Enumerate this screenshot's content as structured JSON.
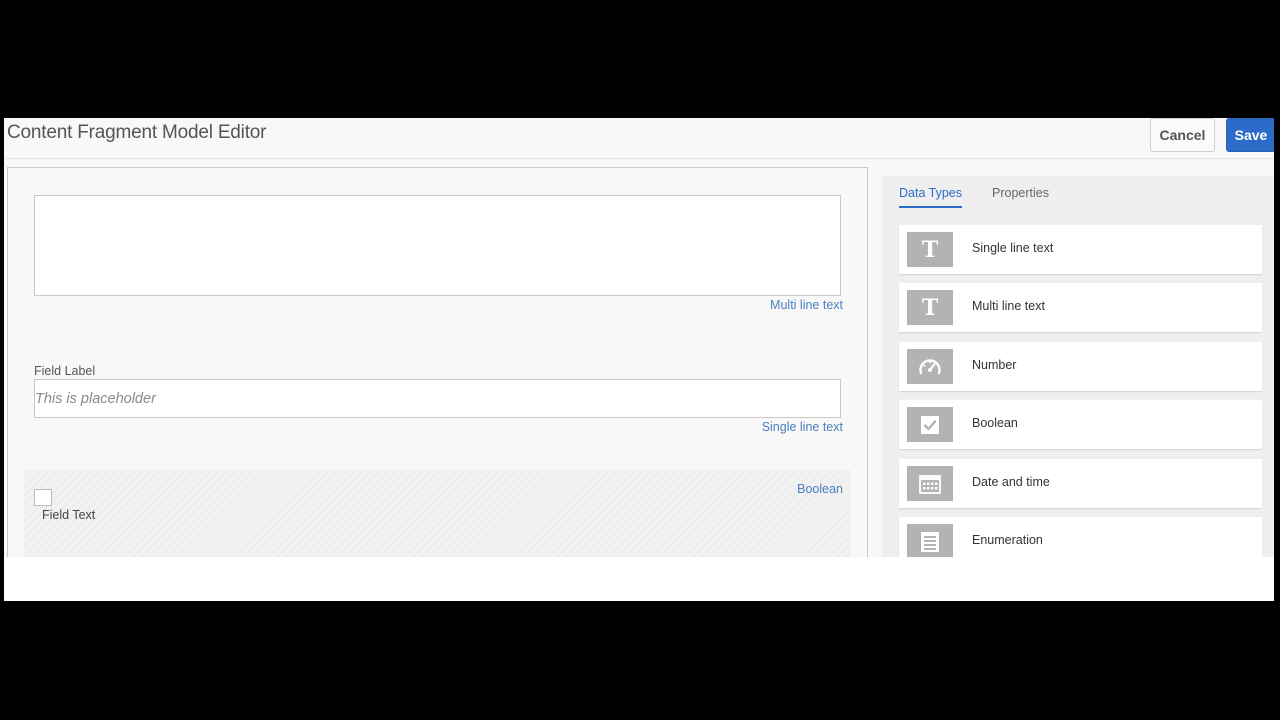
{
  "header": {
    "title": "Content Fragment Model Editor",
    "cancel_label": "Cancel",
    "save_label": "Save",
    "accent_color": "#2d6bc9"
  },
  "canvas": {
    "multi_line": {
      "type_label": "Multi line text"
    },
    "single_line": {
      "field_label": "Field Label",
      "placeholder": "This is placeholder",
      "type_label": "Single line text"
    },
    "boolean": {
      "type_label": "Boolean",
      "field_text": "Field Text"
    }
  },
  "sidepanel": {
    "tabs": [
      {
        "label": "Data Types",
        "active": true
      },
      {
        "label": "Properties",
        "active": false
      }
    ],
    "data_types": [
      {
        "label": "Single line text",
        "icon": "text-t-icon"
      },
      {
        "label": "Multi line text",
        "icon": "text-t-icon"
      },
      {
        "label": "Number",
        "icon": "gauge-icon"
      },
      {
        "label": "Boolean",
        "icon": "checkbox-icon"
      },
      {
        "label": "Date and time",
        "icon": "calendar-icon"
      },
      {
        "label": "Enumeration",
        "icon": "list-icon"
      }
    ]
  }
}
